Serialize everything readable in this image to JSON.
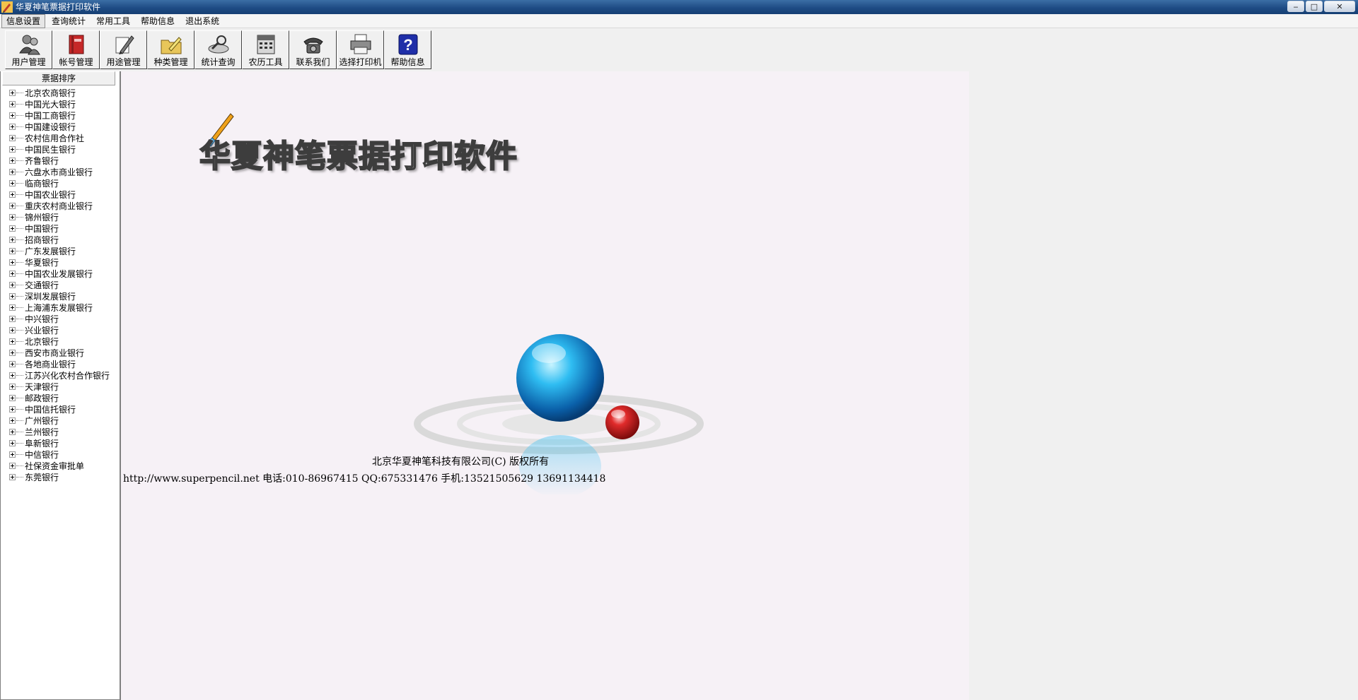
{
  "window": {
    "title": "华夏神笔票据打印软件",
    "controls": [
      "minimize",
      "maximize",
      "close"
    ]
  },
  "menu": {
    "items": [
      "信息设置",
      "查询统计",
      "常用工具",
      "帮助信息",
      "退出系统"
    ]
  },
  "toolbar": {
    "buttons": [
      {
        "label": "用户管理",
        "icon": "users-icon"
      },
      {
        "label": "帐号管理",
        "icon": "account-book-icon"
      },
      {
        "label": "用途管理",
        "icon": "pencil-icon"
      },
      {
        "label": "种类管理",
        "icon": "category-folder-icon"
      },
      {
        "label": "统计查询",
        "icon": "magnifier-icon"
      },
      {
        "label": "农历工具",
        "icon": "calendar-icon"
      },
      {
        "label": "联系我们",
        "icon": "telephone-icon"
      },
      {
        "label": "选择打印机",
        "icon": "printer-icon"
      },
      {
        "label": "帮助信息",
        "icon": "help-icon"
      }
    ]
  },
  "tree": {
    "header": "票据排序",
    "items": [
      "北京农商银行",
      "中国光大银行",
      "中国工商银行",
      "中国建设银行",
      "农村信用合作社",
      "中国民生银行",
      "齐鲁银行",
      "六盘水市商业银行",
      "临商银行",
      "中国农业银行",
      "重庆农村商业银行",
      "锦州银行",
      "中国银行",
      "招商银行",
      "广东发展银行",
      "华夏银行",
      "中国农业发展银行",
      "交通银行",
      "深圳发展银行",
      "上海浦东发展银行",
      "中兴银行",
      "兴业银行",
      "北京银行",
      "西安市商业银行",
      "各地商业银行",
      "江苏兴化农村合作银行",
      "天津银行",
      "邮政银行",
      "中国信托银行",
      "广州银行",
      "兰州银行",
      "阜新银行",
      "中信银行",
      "社保资金审批单",
      "东莞银行"
    ]
  },
  "splash": {
    "logo_text": "华夏神笔票据打印软件",
    "copyright": "北京华夏神笔科技有限公司(C) 版权所有",
    "contact": "http://www.superpencil.net  电话:010-86967415 QQ:675331476  手机:13521505629 13691134418"
  }
}
